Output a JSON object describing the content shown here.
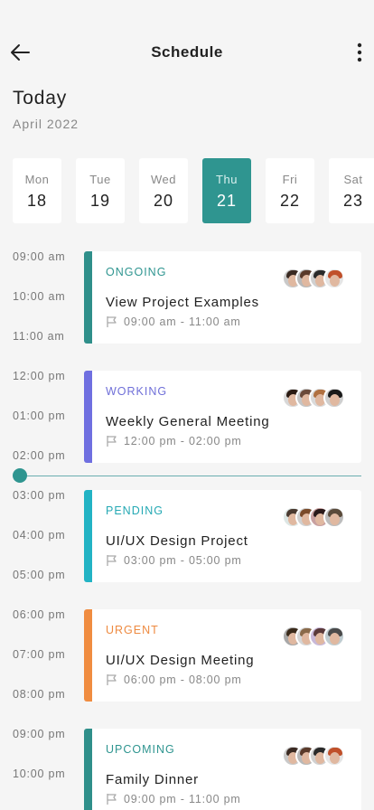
{
  "header": {
    "title": "Schedule"
  },
  "today_label": "Today",
  "month_label": "April 2022",
  "days": [
    {
      "name": "Mon",
      "num": "18"
    },
    {
      "name": "Tue",
      "num": "19"
    },
    {
      "name": "Wed",
      "num": "20"
    },
    {
      "name": "Thu",
      "num": "21",
      "active": true
    },
    {
      "name": "Fri",
      "num": "22"
    },
    {
      "name": "Sat",
      "num": "23"
    }
  ],
  "times": [
    "09:00 am",
    "10:00 am",
    "11:00 am",
    "12:00 pm",
    "01:00 pm",
    "02:00 pm",
    "03:00 pm",
    "04:00 pm",
    "05:00 pm",
    "06:00 pm",
    "07:00 pm",
    "08:00 pm",
    "09:00 pm",
    "10:00 pm"
  ],
  "events": [
    {
      "status": "ONGOING",
      "title": "View Project Examples",
      "time": "09:00 am - 11:00 am",
      "color": "#2f8f8a",
      "status_color": "#2f9590"
    },
    {
      "status": "WORKING",
      "title": "Weekly General Meeting",
      "time": "12:00 pm - 02:00 pm",
      "color": "#6f6fe0",
      "status_color": "#6f6fd8"
    },
    {
      "status": "PENDING",
      "title": "UI/UX Design Project",
      "time": "03:00 pm - 05:00 pm",
      "color": "#22b3c4",
      "status_color": "#25a9b4"
    },
    {
      "status": "URGENT",
      "title": "UI/UX Design Meeting",
      "time": "06:00 pm - 08:00 pm",
      "color": "#f08c40",
      "status_color": "#ee8a40"
    },
    {
      "status": "UPCOMING",
      "title": "Family Dinner",
      "time": "09:00 pm - 11:00 pm",
      "color": "#2f8f8a",
      "status_color": "#2f9590"
    }
  ],
  "colors": {
    "accent": "#2f9590",
    "background": "#f5f5f5",
    "now_line": "#6aaeb0"
  }
}
